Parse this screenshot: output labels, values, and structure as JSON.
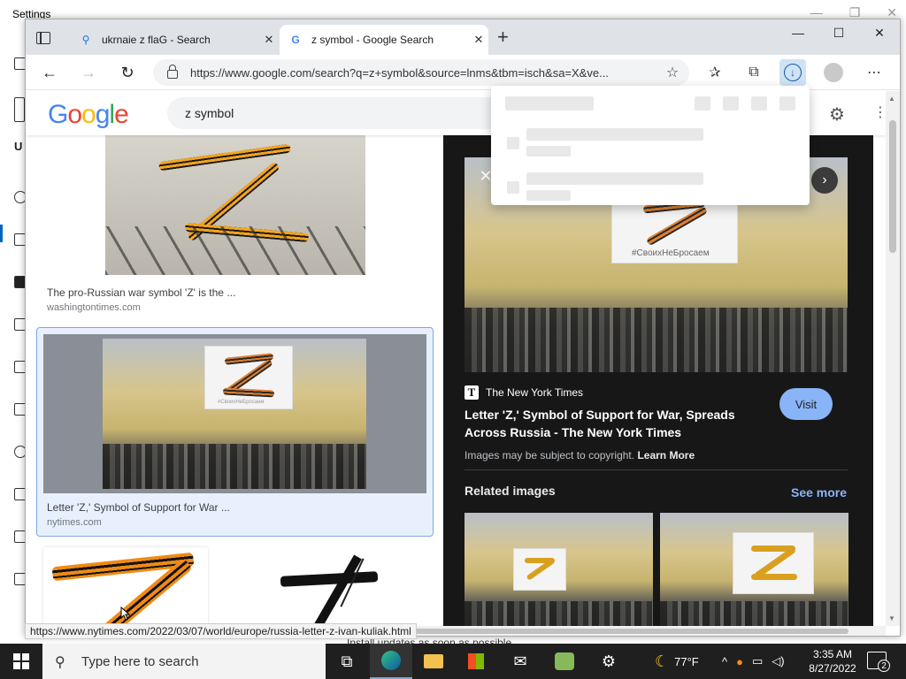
{
  "background_window": {
    "title": "Settings",
    "side_letter": "U",
    "update_text": "Install updates as soon as possible"
  },
  "tabs": [
    {
      "title": "ukrnaie z flaG - Search",
      "favicon": "search-icon",
      "active": false
    },
    {
      "title": "z symbol - Google Search",
      "favicon": "google-g-icon",
      "active": true
    }
  ],
  "toolbar": {
    "url": "https://www.google.com/search?q=z+symbol&source=lnms&tbm=isch&sa=X&ve..."
  },
  "google": {
    "logo": "Google",
    "query": "z symbol"
  },
  "results": [
    {
      "title": "The pro-Russian war symbol 'Z' is the ...",
      "source": "washingtontimes.com"
    },
    {
      "title": "Letter 'Z,' Symbol of Support for War ...",
      "source": "nytimes.com"
    }
  ],
  "preview": {
    "publisher": "The New York Times",
    "publisher_logo": "T",
    "title": "Letter 'Z,' Symbol of Support for War, Spreads Across Russia - The New York Times",
    "visit_label": "Visit",
    "copyright": "Images may be subject to copyright.",
    "learn_more": "Learn More",
    "related_heading": "Related images",
    "see_more": "See more",
    "billboard_text": "#СвоихНеБросаем"
  },
  "status_url": "https://www.nytimes.com/2022/03/07/world/europe/russia-letter-z-ivan-kuliak.html",
  "taskbar": {
    "search_placeholder": "Type here to search",
    "weather": "77°F",
    "time": "3:35 AM",
    "date": "8/27/2022",
    "notification_count": "2"
  }
}
